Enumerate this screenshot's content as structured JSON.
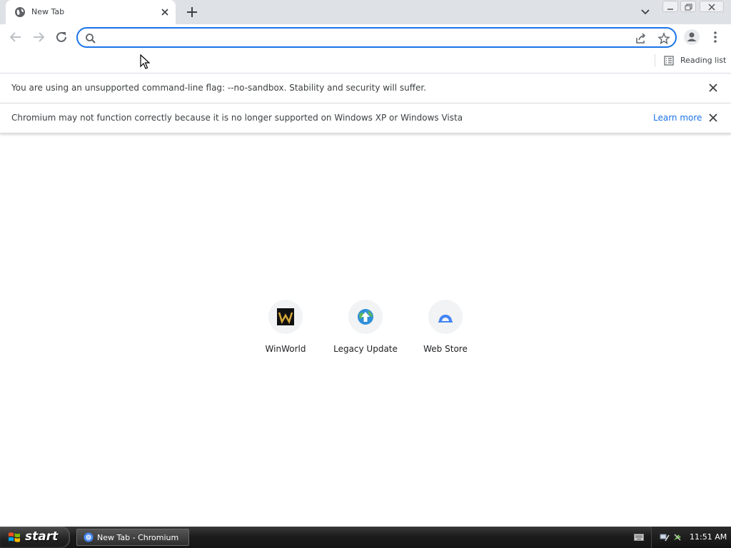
{
  "browser": {
    "tab": {
      "title": "New Tab"
    },
    "omnibox": {
      "value": "",
      "placeholder": ""
    },
    "bookmarks_bar": {
      "reading_list_label": "Reading list"
    }
  },
  "infobars": [
    {
      "message": "You are using an unsupported command-line flag: --no-sandbox. Stability and security will suffer."
    },
    {
      "message": "Chromium may not function correctly because it is no longer supported on Windows XP or Windows Vista",
      "link": "Learn more"
    }
  ],
  "shortcuts": [
    {
      "label": "WinWorld",
      "icon": "winworld-logo-icon"
    },
    {
      "label": "Legacy Update",
      "icon": "legacy-update-icon"
    },
    {
      "label": "Web Store",
      "icon": "web-store-icon"
    }
  ],
  "taskbar": {
    "start_label": "start",
    "task_item": "New Tab - Chromium",
    "clock": "11:51 AM"
  },
  "colors": {
    "accent": "#1a73e8",
    "tabstrip": "#dee1e6"
  }
}
